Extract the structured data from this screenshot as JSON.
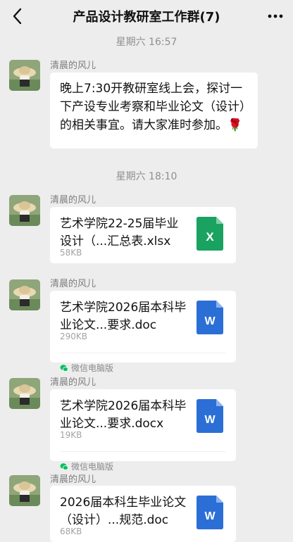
{
  "header": {
    "title": "产品设计教研室工作群(7)"
  },
  "messages": [
    {
      "time": "星期六 16:57",
      "sender": "清晨的风儿",
      "text": "晚上7:30开教研室线上会，探讨一下产设专业考察和毕业论文（设计）的相关事宜。请大家准时参加。🌹"
    },
    {
      "time": "星期六 18:10",
      "sender": "清晨的风儿",
      "file_name": "艺术学院22-25届毕业设计（...汇总表.xlsx",
      "file_size": "58KB",
      "icon": "excel-icon",
      "icon_letter": "X"
    },
    {
      "sender": "清晨的风儿",
      "file_name": "艺术学院2026届本科毕业论文...要求.doc",
      "file_size": "290KB",
      "icon": "word-icon",
      "icon_letter": "W",
      "source": "微信电脑版"
    },
    {
      "sender": "清晨的风儿",
      "file_name": "艺术学院2026届本科毕业论文...要求.docx",
      "file_size": "19KB",
      "icon": "word-icon",
      "icon_letter": "W",
      "source": "微信电脑版"
    },
    {
      "sender": "清晨的风儿",
      "file_name": "2026届本科生毕业论文（设计）...规范.doc",
      "file_size": "68KB",
      "icon": "word-icon",
      "icon_letter": "W"
    }
  ],
  "colors": {
    "background": "#ededed",
    "bubble": "#ffffff",
    "excel": "#1aa260",
    "word": "#2b6fd6",
    "wechat_green": "#07c160"
  }
}
